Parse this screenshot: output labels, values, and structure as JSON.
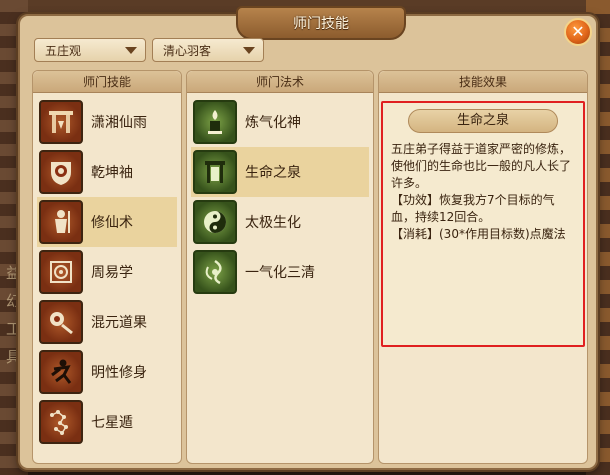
{
  "background": {
    "left_glyphs": [
      "益",
      "幻",
      "工",
      "具"
    ]
  },
  "window": {
    "title": "师门技能",
    "close_label": "✕"
  },
  "filters": {
    "sect": "五庄观",
    "skill_set": "清心羽客"
  },
  "columns": {
    "skills_header": "师门技能",
    "spells_header": "师门法术",
    "effect_header": "技能效果"
  },
  "skills": [
    {
      "label": "潇湘仙雨",
      "icon": "pillar-gate-icon"
    },
    {
      "label": "乾坤袖",
      "icon": "yin-yang-shield-icon"
    },
    {
      "label": "修仙术",
      "icon": "warrior-figure-icon",
      "selected": true
    },
    {
      "label": "周易学",
      "icon": "spiral-seal-icon"
    },
    {
      "label": "混元道果",
      "icon": "orb-staff-icon"
    },
    {
      "label": "明性修身",
      "icon": "running-figure-icon"
    },
    {
      "label": "七星遁",
      "icon": "constellation-icon"
    }
  ],
  "spells": [
    {
      "label": "炼气化神",
      "icon": "flame-tower-icon"
    },
    {
      "label": "生命之泉",
      "icon": "spring-gate-icon",
      "selected": true
    },
    {
      "label": "太极生化",
      "icon": "taiji-icon"
    },
    {
      "label": "一气化三清",
      "icon": "spirit-swirl-icon"
    }
  ],
  "effect": {
    "skill_name": "生命之泉",
    "description": "五庄弟子得益于道家严密的修炼，使他们的生命也比一般的凡人长了许多。",
    "function_line": "【功效】恢复我方7个目标的气血，持续12回合。",
    "cost_line": "【消耗】(30*作用目标数)点魔法"
  },
  "colors": {
    "highlight_border": "#e02020",
    "panel": "#f3e6cc",
    "selected_row": "#ead39e"
  }
}
